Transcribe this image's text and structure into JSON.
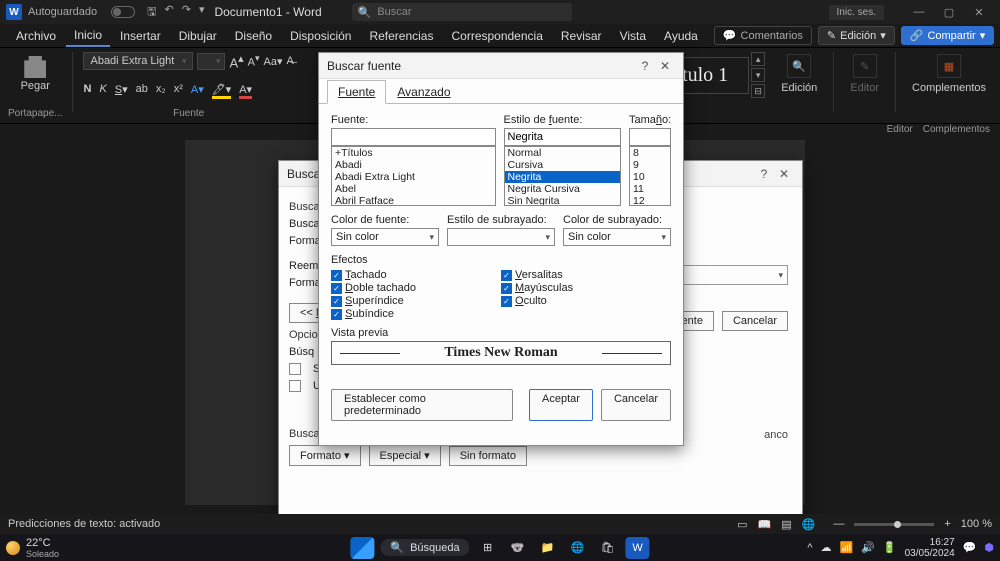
{
  "titlebar": {
    "autosave": "Autoguardado",
    "doc_title": "Documento1 - Word",
    "search_placeholder": "Buscar",
    "signin": "Inic. ses."
  },
  "menus": [
    "Archivo",
    "Inicio",
    "Insertar",
    "Dibujar",
    "Diseño",
    "Disposición",
    "Referencias",
    "Correspondencia",
    "Revisar",
    "Vista",
    "Ayuda"
  ],
  "menu_active": "Inicio",
  "menu_right": {
    "comments": "Comentarios",
    "editing": "Edición",
    "share": "Compartir"
  },
  "ribbon": {
    "paste_label": "Pegar",
    "clipboard_group": "Portapape...",
    "font_group": "Fuente",
    "font_name": "Abadi Extra Light",
    "style_box": "Título 1",
    "editing_group": "Edición",
    "editor_group": "Editor",
    "addins_group": "Complementos",
    "addins_label": "Complementos"
  },
  "status": {
    "predictions": "Predicciones de texto: activado",
    "zoom": "100 %"
  },
  "taskbar": {
    "temp": "22°C",
    "weather": "Soleado",
    "search": "Búsqueda",
    "time": "16:27",
    "date": "03/05/2024"
  },
  "dlg_back": {
    "title": "Buscar ...",
    "buscar": "Busca",
    "buscar2": "Busca",
    "forma": "Forma",
    "reemp": "Reemp",
    "forma2": "Forma",
    "ltlt": "<< ",
    "opcio": "Opcio",
    "busq": "Búsq",
    "chk_s": "S",
    "chk_u": "U",
    "siguiente": "siguiente",
    "cancelar": "Cancelar",
    "anco": "anco",
    "buscar_section": "Buscar",
    "formato": "Formato",
    "especial": "Especial",
    "sinformato": "Sin formato"
  },
  "dlg_front": {
    "title": "Buscar fuente",
    "tabs": [
      "Fuente",
      "Avanzado"
    ],
    "labels": {
      "fuente": "Fuente:",
      "estilo": "Estilo de fuente:",
      "tamano": "Tamaño:",
      "color_fuente": "Color de fuente:",
      "estilo_sub": "Estilo de subrayado:",
      "color_sub": "Color de subrayado:",
      "efectos": "Efectos",
      "vista": "Vista previa"
    },
    "estilo_value": "Negrita",
    "fonts": [
      "+Títulos",
      "Abadi",
      "Abadi Extra Light",
      "Abel",
      "Abril Fatface"
    ],
    "styles": [
      "Normal",
      "Cursiva",
      "Negrita",
      "Negrita Cursiva",
      "Sin Negrita"
    ],
    "style_selected": "Negrita",
    "sizes": [
      "8",
      "9",
      "10",
      "11",
      "12"
    ],
    "sin_color": "Sin color",
    "effects_left": [
      "Tachado",
      "Doble tachado",
      "Superíndice",
      "Subíndice"
    ],
    "effects_right": [
      "Versalitas",
      "Mayúsculas",
      "Oculto"
    ],
    "preview": "Times New Roman",
    "establecer": "Establecer como predeterminado",
    "aceptar": "Aceptar",
    "cancelar": "Cancelar"
  }
}
